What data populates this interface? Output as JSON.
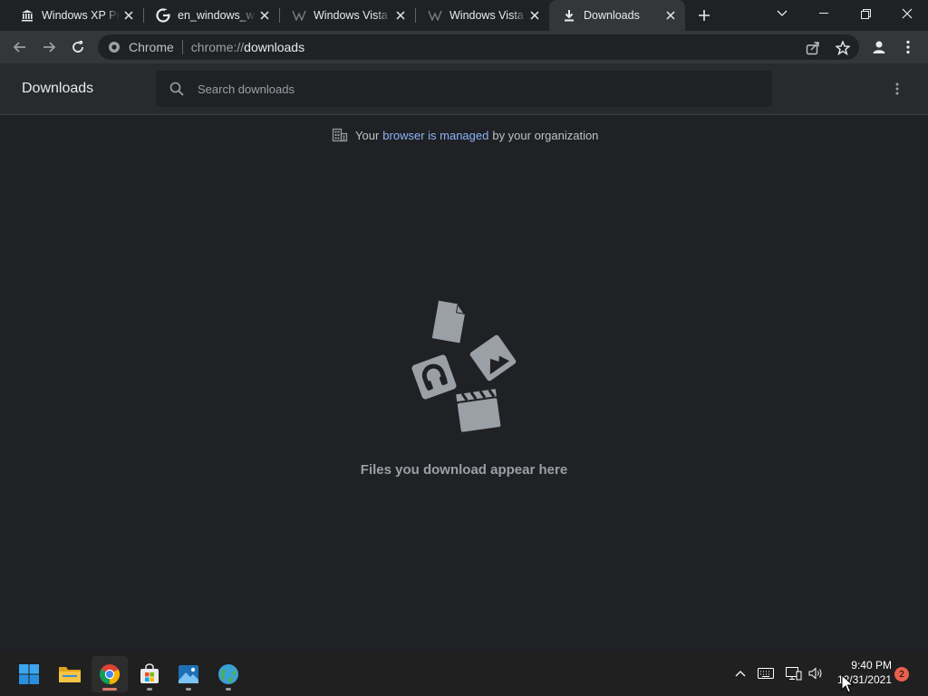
{
  "tabs": [
    {
      "title": "Windows XP Professional",
      "icon": "bank-icon",
      "active": false
    },
    {
      "title": "en_windows_with",
      "icon": "google-icon",
      "active": false
    },
    {
      "title": "Windows Vista (",
      "icon": "wikipedia-icon",
      "active": false
    },
    {
      "title": "Windows Vista (",
      "icon": "wikipedia-icon",
      "active": false
    },
    {
      "title": "Downloads",
      "icon": "download-icon",
      "active": true
    }
  ],
  "omnibox": {
    "site_label": "Chrome",
    "url_scheme": "chrome://",
    "url_path": "downloads"
  },
  "downloads_page": {
    "title": "Downloads",
    "search_placeholder": "Search downloads",
    "managed_prefix": "Your",
    "managed_link": "browser is managed",
    "managed_suffix": "by your organization",
    "empty_message": "Files you download appear here"
  },
  "taskbar": {
    "apps": [
      "start-icon",
      "file-explorer-icon",
      "chrome-icon",
      "store-icon",
      "photos-icon",
      "browser-globe-icon"
    ],
    "clock_time": "9:40 PM",
    "clock_date": "12/31/2021",
    "notification_count": "2"
  },
  "colors": {
    "background": "#202124",
    "toolbar": "#35363a",
    "link": "#8ab4f8",
    "badge": "#e8604c"
  }
}
